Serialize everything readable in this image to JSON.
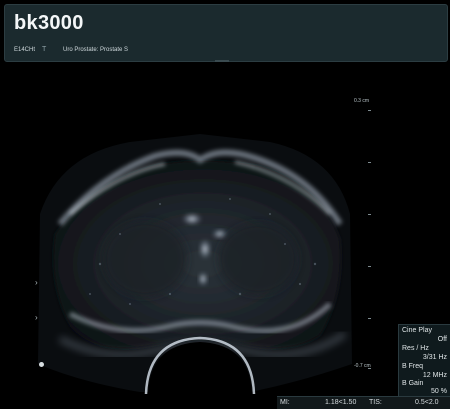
{
  "header": {
    "title": "bk3000",
    "probe": "E14CHt",
    "probe_marker": "T",
    "preset": "Uro Prostate: Prostate S"
  },
  "depth": {
    "top_label": "0.3 cm",
    "bottom_label": "-0.7 cm"
  },
  "side_panel": {
    "cine_label": "Cine Play",
    "cine_value": "Off",
    "res_label": "Res / Hz",
    "res_value": "3/31 Hz",
    "bfreq_label": "B Freq",
    "bfreq_value": "12 MHz",
    "bgain_label": "B Gain",
    "bgain_value": "50 %"
  },
  "bottom_bar": {
    "mi_label": "MI:",
    "mi_value": "1.18<1.50",
    "tis_label": "TIS:",
    "tis_value": "0.5<2.0"
  },
  "icons": {
    "focus_marker": "angle-right-icon",
    "dot_marker": "dot-icon"
  }
}
